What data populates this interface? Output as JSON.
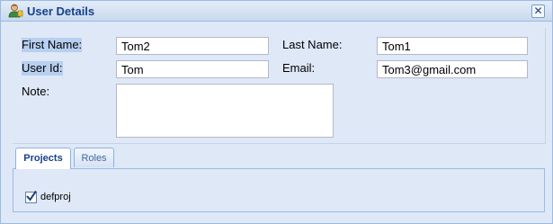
{
  "window": {
    "title": "User Details",
    "close_glyph": "✕",
    "icon": "user-icon"
  },
  "form": {
    "first_name_label": "First Name:",
    "first_name_value": "Tom2",
    "last_name_label": "Last Name:",
    "last_name_value": "Tom1",
    "user_id_label": "User Id:",
    "user_id_value": "Tom",
    "email_label": "Email:",
    "email_value": "Tom3@gmail.com",
    "note_label": "Note:",
    "note_value": ""
  },
  "tabs": [
    {
      "label": "Projects",
      "active": true
    },
    {
      "label": "Roles",
      "active": false
    }
  ],
  "projects": [
    {
      "label": "defproj",
      "checked": true
    }
  ],
  "colors": {
    "title_text": "#15428b",
    "panel_bg": "#dfe8f6",
    "border": "#99bbe8",
    "label_highlight": "#b8cff0"
  }
}
